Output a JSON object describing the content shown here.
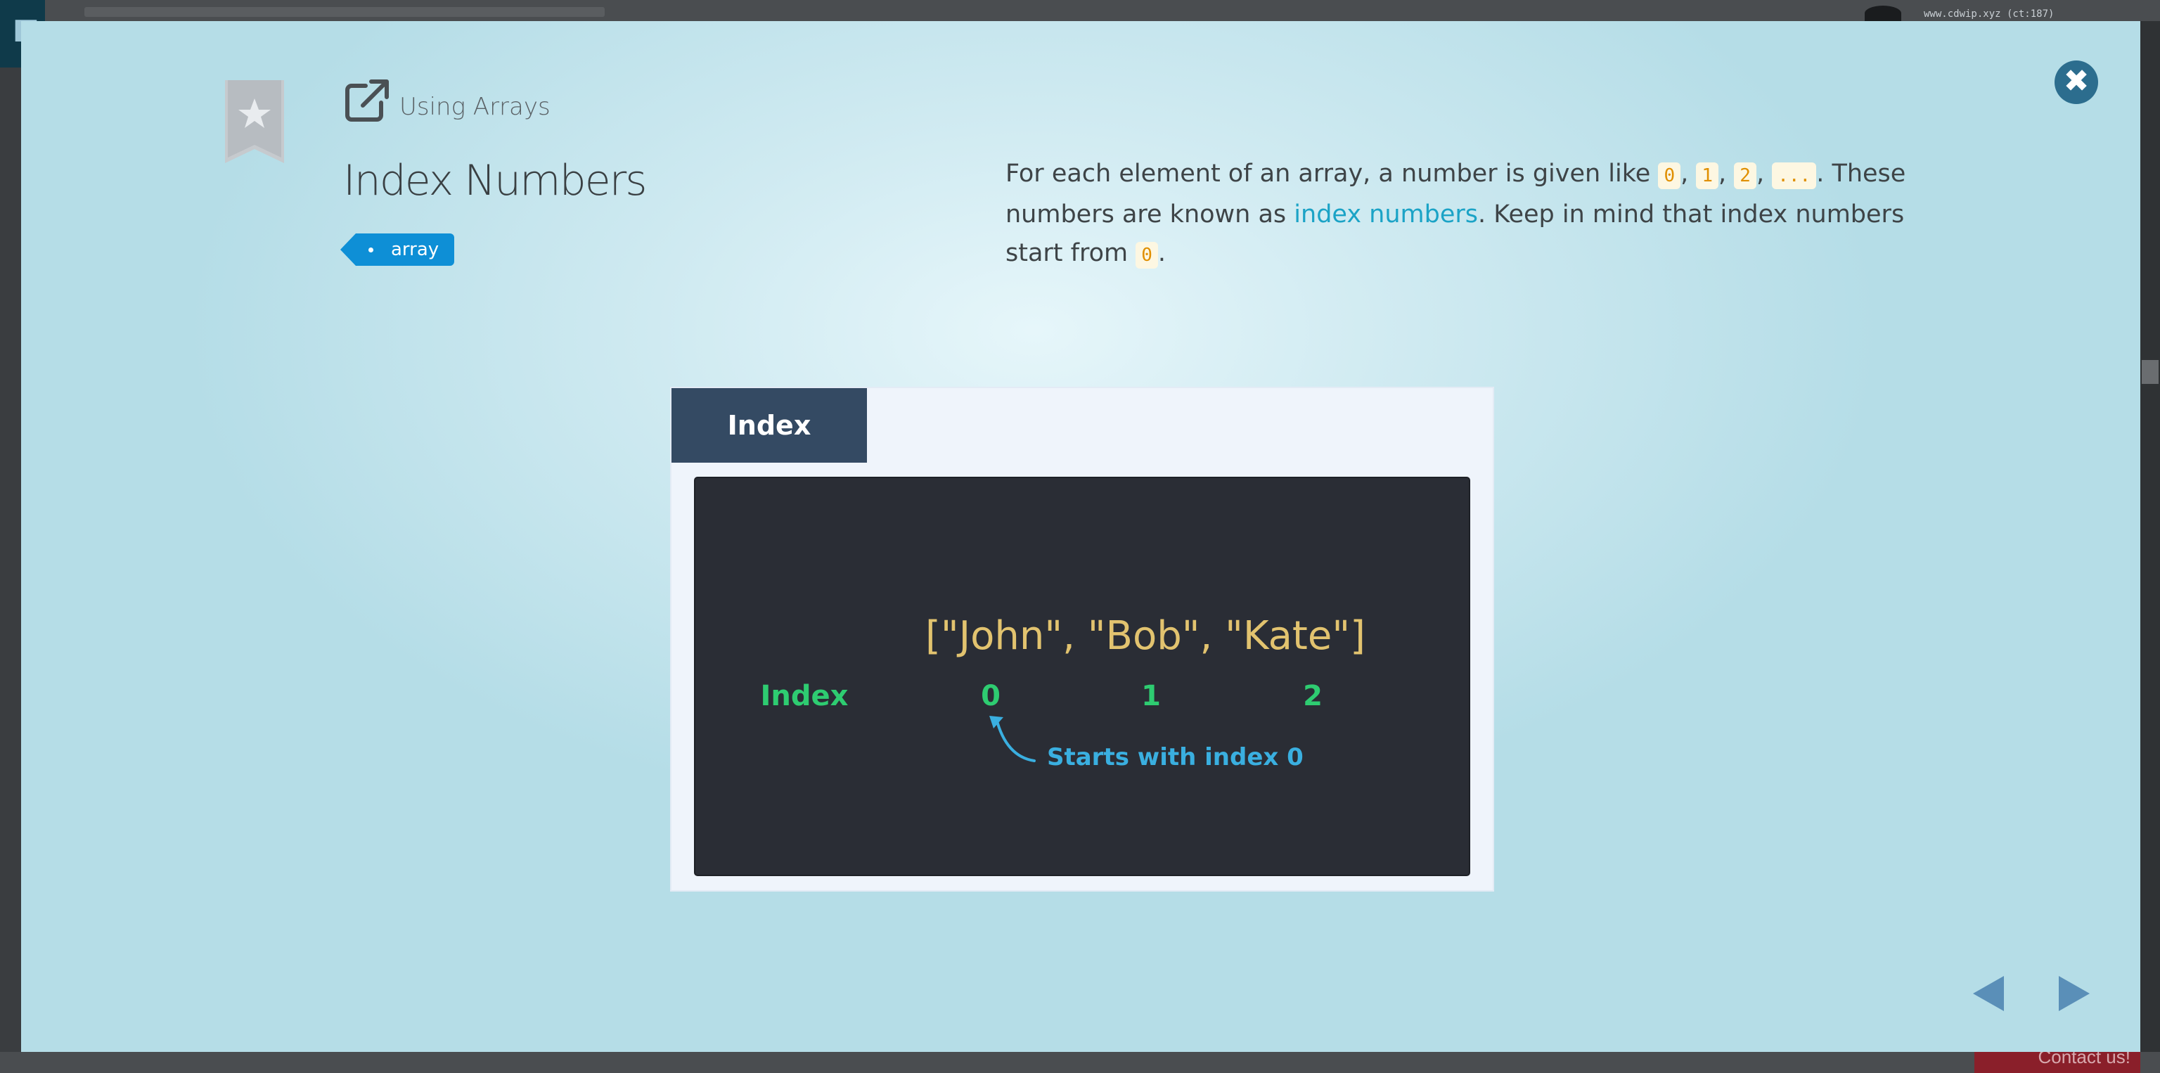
{
  "background": {
    "url_text": "www.cdwip.xyz (ct:187)",
    "contact_label": "Contact us!"
  },
  "modal": {
    "lesson_name": "Using Arrays",
    "title": "Index Numbers",
    "tag": "array",
    "description": {
      "part1": "For each element of an array, a number is given like ",
      "code_0": "0",
      "sep1": ", ",
      "code_1": "1",
      "sep2": ", ",
      "code_2": "2",
      "sep3": ", ",
      "code_ellipsis": "...",
      "part2": ". These numbers are known as ",
      "highlight": "index numbers",
      "part3": ". Keep in mind that index numbers start from ",
      "code_start": "0",
      "part4": "."
    },
    "card": {
      "tab_label": "Index",
      "array_literal": "[\"John\", \"Bob\", \"Kate\"]",
      "index_label": "Index",
      "indices": [
        "0",
        "1",
        "2"
      ],
      "annotation": "Starts with index 0"
    }
  },
  "colors": {
    "accent_blue": "#0e8fd6",
    "highlight": "#1ba3c6",
    "code_orange": "#e08f00",
    "diagram_yellow": "#e2c36f",
    "diagram_green": "#2ecc71",
    "diagram_blue": "#3aafe0",
    "close_button": "#2c6d8e",
    "nav_arrows": "#5a8fb8"
  },
  "icons": {
    "close": "close-icon",
    "bookmark": "bookmark-star-icon",
    "external_link": "external-link-icon",
    "prev": "triangle-left-icon",
    "next": "triangle-right-icon"
  }
}
